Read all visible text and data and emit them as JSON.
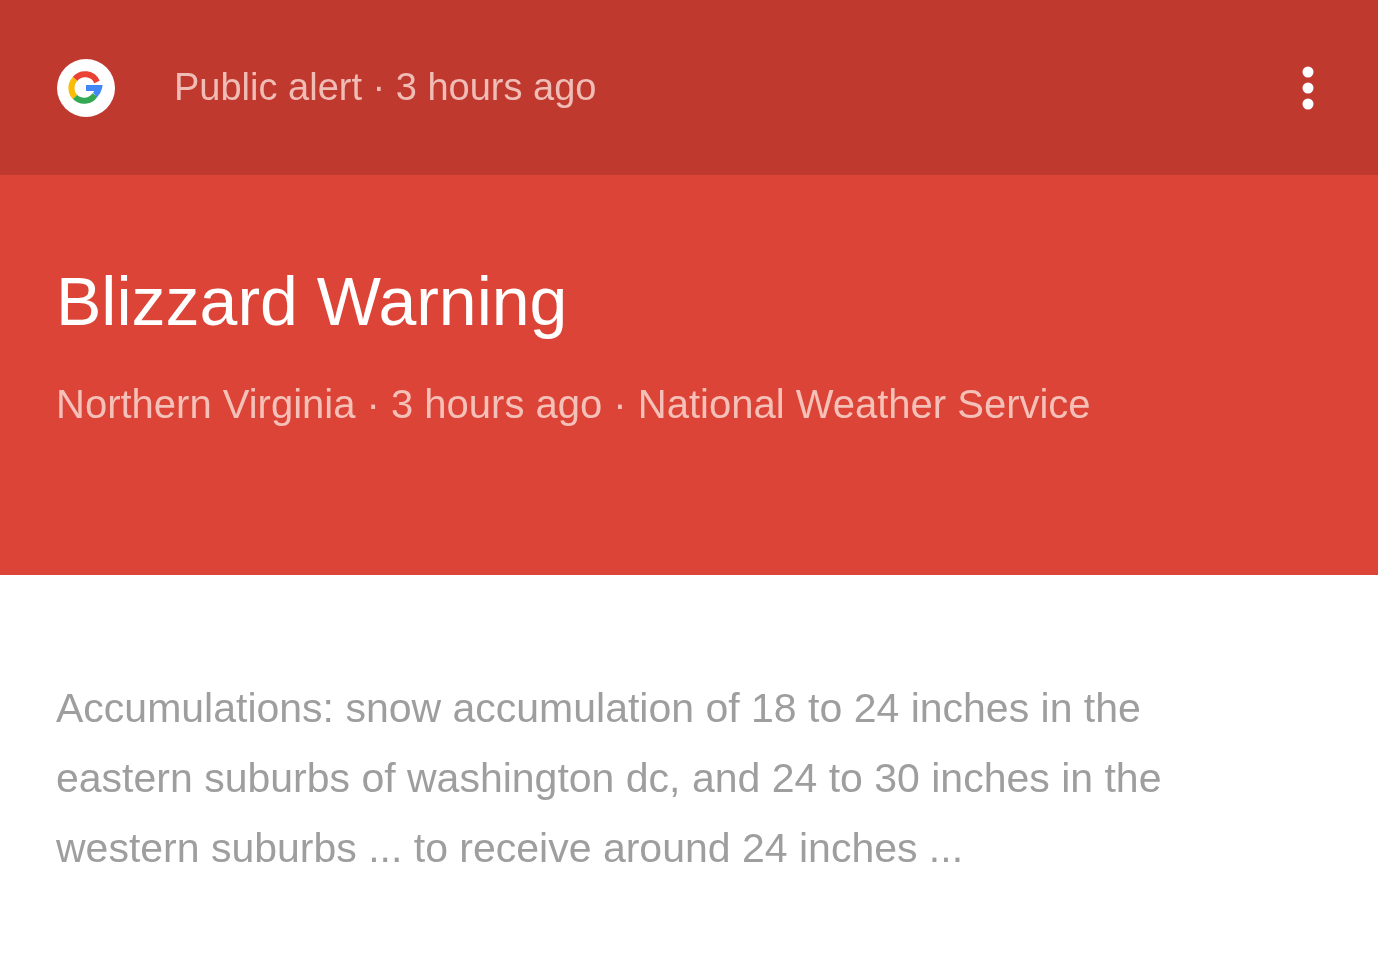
{
  "header": {
    "meta": "Public alert · 3 hours ago"
  },
  "alert": {
    "title": "Blizzard Warning",
    "subtitle": "Northern Virginia · 3 hours ago · National Weather Service"
  },
  "body": {
    "text": "Accumulations: snow accumulation of 18 to 24 inches in the eastern suburbs of washington dc, and 24 to 30 inches in the western suburbs ... to receive around 24 inches ..."
  }
}
